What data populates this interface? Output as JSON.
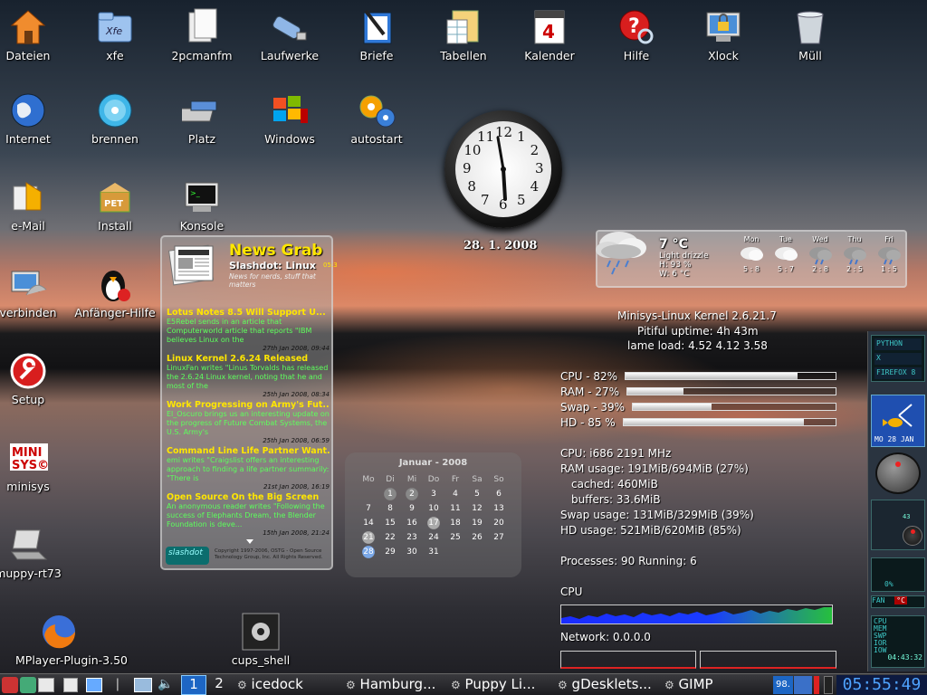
{
  "desktop_icons": [
    {
      "label": "Dateien",
      "icon": "home-folder-icon"
    },
    {
      "label": "xfe",
      "icon": "xfe-folder-icon"
    },
    {
      "label": "2pcmanfm",
      "icon": "documents-icon"
    },
    {
      "label": "Laufwerke",
      "icon": "usb-drive-icon"
    },
    {
      "label": "Briefe",
      "icon": "pen-document-icon"
    },
    {
      "label": "Tabellen",
      "icon": "spreadsheet-icon"
    },
    {
      "label": "Kalender",
      "icon": "calendar-icon"
    },
    {
      "label": "Hilfe",
      "icon": "help-icon"
    },
    {
      "label": "Xlock",
      "icon": "lock-screen-icon"
    },
    {
      "label": "Müll",
      "icon": "trash-icon"
    },
    {
      "label": "Internet",
      "icon": "globe-icon"
    },
    {
      "label": "brennen",
      "icon": "disc-burn-icon"
    },
    {
      "label": "Platz",
      "icon": "disk-space-icon"
    },
    {
      "label": "Windows",
      "icon": "windows-logo-icon"
    },
    {
      "label": "autostart",
      "icon": "gears-icon"
    },
    {
      "label": "e-Mail",
      "icon": "email-icon"
    },
    {
      "label": "Install",
      "icon": "package-icon"
    },
    {
      "label": "Konsole",
      "icon": "terminal-icon"
    },
    {
      "label": "verbinden",
      "icon": "network-connect-icon"
    },
    {
      "label": "Anfänger-Hilfe",
      "icon": "penguin-help-icon"
    },
    {
      "label": "Setup",
      "icon": "setup-wrench-icon"
    },
    {
      "label": "minisys",
      "icon": "minisys-logo-icon"
    },
    {
      "label": "muppy-rt73",
      "icon": "laptop-icon"
    },
    {
      "label": "MPlayer-Plugin-3.50",
      "icon": "firefox-icon"
    },
    {
      "label": "cups_shell",
      "icon": "printer-gear-icon"
    }
  ],
  "clock": {
    "date": "28. 1. 2008",
    "numbers": [
      "12",
      "1",
      "2",
      "3",
      "4",
      "5",
      "6",
      "7",
      "8",
      "9",
      "10",
      "11"
    ]
  },
  "news": {
    "title": "News Grab",
    "source": "Slashdot: Linux",
    "source_extra": "05:3",
    "tagline": "News for nerds, stuff that matters",
    "items": [
      {
        "title": "Lotus Notes 8.5 Will Support U...",
        "body": "E5Rebel sends in an article that Computerworld article that reports \"IBM believes Linux on the",
        "date": "27th Jan 2008, 09:44"
      },
      {
        "title": "Linux Kernel 2.6.24 Released",
        "body": "LinuxFan writes \"Linus Torvalds has released the 2.6.24 Linux kernel, noting that he and most of the",
        "date": "25th Jan 2008, 08:34"
      },
      {
        "title": "Work Progressing on Army's Fut...",
        "body": "El_Oscuro brings us an interesting update on the progress of Future Combat Systems, the U.S. Army's",
        "date": "25th Jan 2008, 06:59"
      },
      {
        "title": "Command Line Life Partner Want...",
        "body": "emi writes \"Craigslist offers an interesting approach to finding a life partner summarily: \"There is",
        "date": "21st Jan 2008, 16:19"
      },
      {
        "title": "Open Source On the Big Screen",
        "body": "An anonymous reader writes \"Following the success of Elephants Dream, the Blender Foundation is deve...",
        "date": "15th Jan 2008, 21:24"
      }
    ],
    "logo": "slashdot",
    "copyright": "Copyright 1997-2006, OSTG - Open Source Technology Group, Inc. All Rights Reserved."
  },
  "calendar": {
    "title": "Januar - 2008",
    "headers": [
      "Mo",
      "Di",
      "Mi",
      "Do",
      "Fr",
      "Sa",
      "So"
    ],
    "rows": [
      [
        "",
        "1",
        "2",
        "3",
        "4",
        "5",
        "6"
      ],
      [
        "7",
        "8",
        "9",
        "10",
        "11",
        "12",
        "13"
      ],
      [
        "14",
        "15",
        "16",
        "17",
        "18",
        "19",
        "20"
      ],
      [
        "21",
        "22",
        "23",
        "24",
        "25",
        "26",
        "27"
      ],
      [
        "28",
        "29",
        "30",
        "31",
        "",
        "",
        ""
      ]
    ]
  },
  "weather": {
    "temp": "7 °C",
    "condition": "Light drizzle",
    "humidity": "H: 93 %",
    "wind": "W: 6 °C",
    "days": [
      {
        "day": "Mon",
        "range": "5 : 8"
      },
      {
        "day": "Tue",
        "range": "5 : 7"
      },
      {
        "day": "Wed",
        "range": "2 : 8"
      },
      {
        "day": "Thu",
        "range": "2 : 5"
      },
      {
        "day": "Fri",
        "range": "1 : 5"
      }
    ]
  },
  "sysinfo": {
    "kernel": "Minisys-Linux Kernel 2.6.21.7",
    "uptime": "Pitiful uptime: 4h 43m",
    "load": "lame load: 4.52 4.12 3.58",
    "cpu_label": "CPU - 82%",
    "cpu_pct": 0.82,
    "ram_label": "RAM - 27%",
    "ram_pct": 0.27,
    "swap_label": "Swap - 39%",
    "swap_pct": 0.39,
    "hd_label": "HD - 85 %",
    "hd_pct": 0.85,
    "cpu_info": "CPU: i686 2191 MHz",
    "ram_usage": "RAM usage: 191MiB/694MiB (27%)",
    "cached": "cached: 460MiB",
    "buffers": "buffers: 33.6MiB",
    "swap_usage": "Swap usage: 131MiB/329MiB (39%)",
    "hd_usage": "HD usage: 521MiB/620MiB (85%)",
    "processes": "Processes: 90  Running: 6",
    "cpu_graph_label": "CPU",
    "network": "Network: 0.0.0.0"
  },
  "dock": {
    "python": "PYTHON",
    "firefox": "FIREFOX 8",
    "date": "MO 28 JAN",
    "num": "43",
    "pct": "0%",
    "fan": "FAN",
    "fan_val": "°C",
    "cpu": "CPU",
    "mem": "MEM",
    "swp": "SWP",
    "ior": "IOR",
    "iow": "IOW",
    "time": "04:43:32"
  },
  "taskbar": {
    "desk1": "1",
    "desk2": "2",
    "tasks": [
      "icedock",
      "Hamburg...",
      "Puppy Li...",
      "gDesklets...",
      "GIMP"
    ],
    "tray_num": "98.",
    "clock": "05:55:49"
  }
}
